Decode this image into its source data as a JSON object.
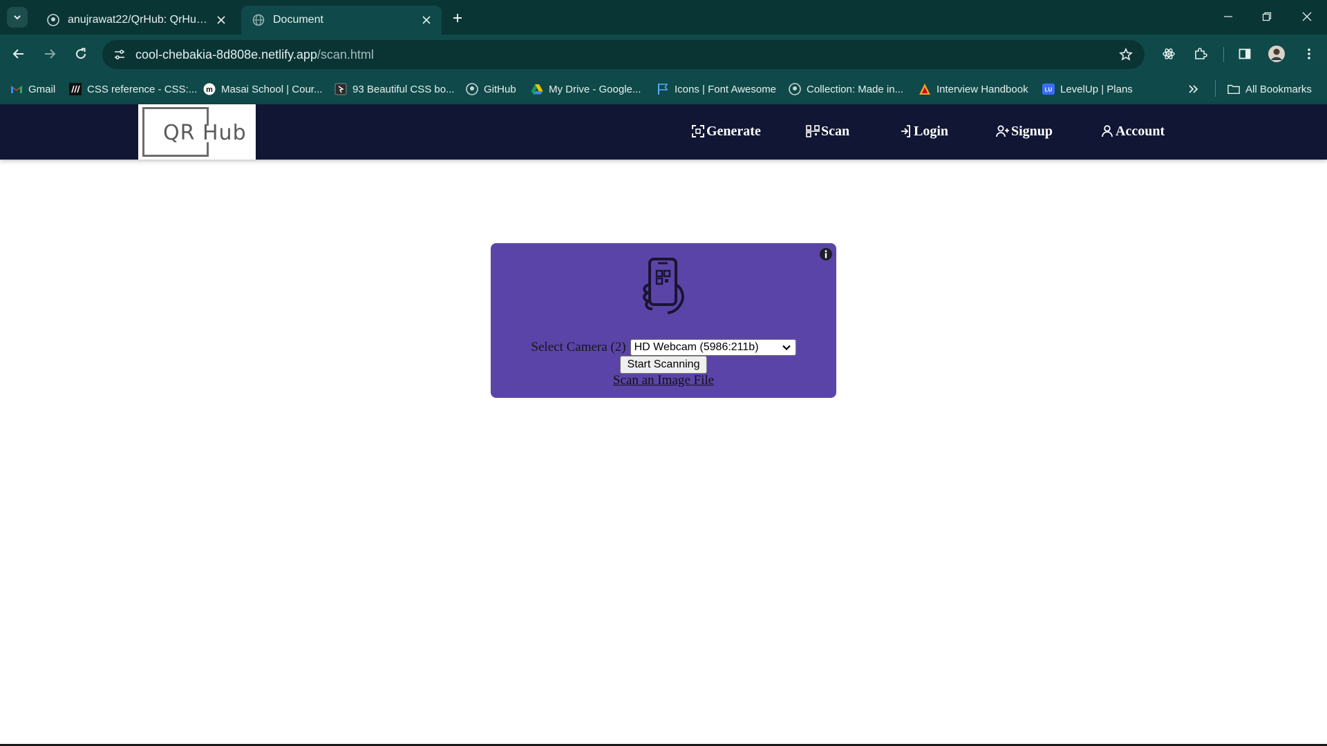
{
  "browser": {
    "tabs": [
      {
        "title": "anujrawat22/QrHub: QrHub is a",
        "active": false
      },
      {
        "title": "Document",
        "active": true
      }
    ],
    "address": {
      "host": "cool-chebakia-8d808e.netlify.app",
      "path": "/scan.html"
    },
    "bookmarks": [
      {
        "label": "Gmail",
        "icon": "gmail-icon"
      },
      {
        "label": "CSS reference - CSS:...",
        "icon": "mdn-icon"
      },
      {
        "label": "Masai School | Cour...",
        "icon": "masai-icon"
      },
      {
        "label": "93 Beautiful CSS bo...",
        "icon": "bookmark-site-icon"
      },
      {
        "label": "GitHub",
        "icon": "github-icon"
      },
      {
        "label": "My Drive - Google...",
        "icon": "google-drive-icon"
      },
      {
        "label": "Icons | Font Awesome",
        "icon": "font-awesome-icon"
      },
      {
        "label": "Collection: Made in...",
        "icon": "github-icon"
      },
      {
        "label": "Interview Handbook",
        "icon": "handbook-icon"
      },
      {
        "label": "LevelUp | Plans",
        "icon": "levelup-icon"
      }
    ],
    "all_bookmarks": "All Bookmarks",
    "colors": {
      "chrome": "#0f4949",
      "tabstrip": "#0a3535"
    }
  },
  "site": {
    "logo": "QR  Hub",
    "nav": {
      "generate": "Generate",
      "scan": "Scan",
      "login": "Login",
      "signup": "Signup",
      "account": "Account"
    },
    "colors": {
      "nav_bg": "#111634",
      "card_bg": "#5b44a8"
    }
  },
  "scanner": {
    "camera_label": "Select Camera (2)",
    "camera_selected": "HD Webcam (5986:211b)",
    "start_button": "Start Scanning",
    "file_link": "Scan an Image File"
  }
}
